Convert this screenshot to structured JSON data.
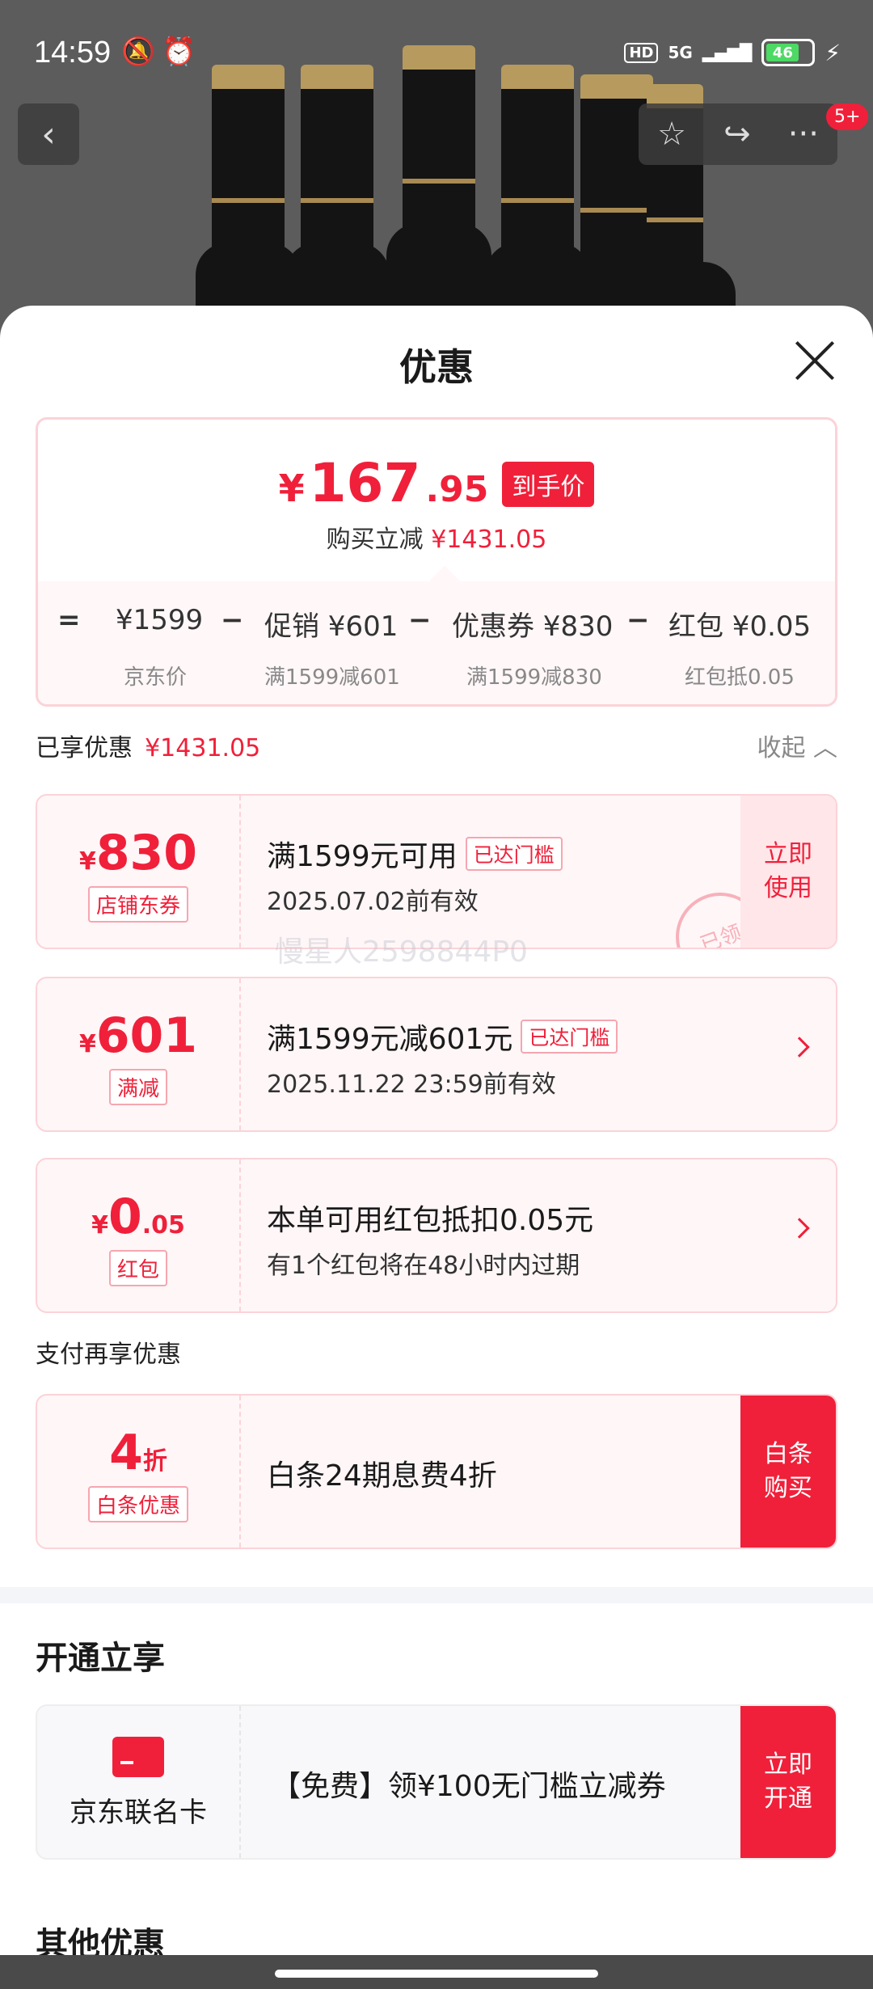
{
  "status": {
    "time": "14:59",
    "left_icons": "🔕⏰",
    "hd": "HD",
    "net": "5G",
    "battery": "46",
    "bolt": "⚡"
  },
  "nav": {
    "back": "‹",
    "star": "☆",
    "share": "↪",
    "more": "···",
    "badge": "5+"
  },
  "sheet": {
    "title": "优惠"
  },
  "price": {
    "yen": "¥",
    "int": "167",
    "dec": ".95",
    "tag": "到手价",
    "instant_label": "购买立减",
    "instant_amt": "¥1431.05",
    "eq": "=",
    "jd_price": "¥1599",
    "jd_label": "京东价",
    "minus": "−",
    "promo": "促销 ¥601",
    "promo_label": "满1599减601",
    "coupon": "优惠券 ¥830",
    "coupon_label": "满1599减830",
    "redpack": "红包 ¥0.05",
    "redpack_label": "红包抵0.05"
  },
  "enjoyed": {
    "label": "已享优惠",
    "amt": "¥1431.05",
    "collapse": "收起 ︿"
  },
  "deals": [
    {
      "yen": "¥",
      "num": "830",
      "dec": "",
      "tag": "店铺东券",
      "title": "满1599元可用",
      "badge": "已达门槛",
      "sub": "2025.07.02前有效",
      "btn": "立即使用",
      "stamp": "已领"
    },
    {
      "yen": "¥",
      "num": "601",
      "dec": "",
      "tag": "满减",
      "title": "满1599元减601元",
      "badge": "已达门槛",
      "sub": "2025.11.22 23:59前有效"
    },
    {
      "yen": "¥",
      "num": "0",
      "dec": ".05",
      "tag": "红包",
      "title": "本单可用红包抵扣0.05元",
      "sub": "有1个红包将在48小时内过期"
    }
  ],
  "pay": {
    "label": "支付再享优惠",
    "num": "4",
    "unit": "折",
    "tag": "白条优惠",
    "title": "白条24期息费4折",
    "btn": "白条购买"
  },
  "open": {
    "heading": "开通立享",
    "card_name": "京东联名卡",
    "title": "【免费】领¥100无门槛立减券",
    "btn": "立即开通"
  },
  "other": {
    "heading": "其他优惠"
  },
  "watermark": "慢星人2598844P0"
}
